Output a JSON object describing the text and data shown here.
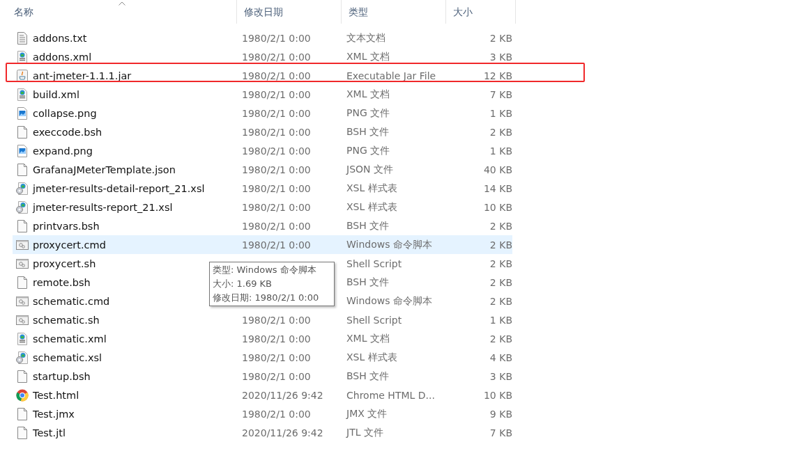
{
  "columns": [
    {
      "label": "名称",
      "sorted": true
    },
    {
      "label": "修改日期",
      "sorted": false
    },
    {
      "label": "类型",
      "sorted": false
    },
    {
      "label": "大小",
      "sorted": false
    }
  ],
  "files": [
    {
      "name": "addons.txt",
      "date": "1980/2/1 0:00",
      "type": "文本文档",
      "size": "2 KB",
      "kind": "text",
      "hovered": false,
      "highlighted": false
    },
    {
      "name": "addons.xml",
      "date": "1980/2/1 0:00",
      "type": "XML 文档",
      "size": "3 KB",
      "kind": "xml",
      "hovered": false,
      "highlighted": false
    },
    {
      "name": "ant-jmeter-1.1.1.jar",
      "date": "1980/2/1 0:00",
      "type": "Executable Jar File",
      "size": "12 KB",
      "kind": "jar",
      "hovered": false,
      "highlighted": true
    },
    {
      "name": "build.xml",
      "date": "1980/2/1 0:00",
      "type": "XML 文档",
      "size": "7 KB",
      "kind": "xml",
      "hovered": false,
      "highlighted": false
    },
    {
      "name": "collapse.png",
      "date": "1980/2/1 0:00",
      "type": "PNG 文件",
      "size": "1 KB",
      "kind": "image",
      "hovered": false,
      "highlighted": false
    },
    {
      "name": "execcode.bsh",
      "date": "1980/2/1 0:00",
      "type": "BSH 文件",
      "size": "2 KB",
      "kind": "blank",
      "hovered": false,
      "highlighted": false
    },
    {
      "name": "expand.png",
      "date": "1980/2/1 0:00",
      "type": "PNG 文件",
      "size": "1 KB",
      "kind": "image",
      "hovered": false,
      "highlighted": false
    },
    {
      "name": "GrafanaJMeterTemplate.json",
      "date": "1980/2/1 0:00",
      "type": "JSON 文件",
      "size": "40 KB",
      "kind": "blank",
      "hovered": false,
      "highlighted": false
    },
    {
      "name": "jmeter-results-detail-report_21.xsl",
      "date": "1980/2/1 0:00",
      "type": "XSL 样式表",
      "size": "14 KB",
      "kind": "xsl",
      "hovered": false,
      "highlighted": false
    },
    {
      "name": "jmeter-results-report_21.xsl",
      "date": "1980/2/1 0:00",
      "type": "XSL 样式表",
      "size": "10 KB",
      "kind": "xsl",
      "hovered": false,
      "highlighted": false
    },
    {
      "name": "printvars.bsh",
      "date": "1980/2/1 0:00",
      "type": "BSH 文件",
      "size": "2 KB",
      "kind": "blank",
      "hovered": false,
      "highlighted": false
    },
    {
      "name": "proxycert.cmd",
      "date": "1980/2/1 0:00",
      "type": "Windows 命令脚本",
      "size": "2 KB",
      "kind": "cmd",
      "hovered": true,
      "highlighted": false
    },
    {
      "name": "proxycert.sh",
      "type": "Shell Script",
      "size": "2 KB",
      "kind": "cmd",
      "hovered": false,
      "highlighted": false
    },
    {
      "name": "remote.bsh",
      "type": "BSH 文件",
      "size": "2 KB",
      "kind": "blank",
      "hovered": false,
      "highlighted": false
    },
    {
      "name": "schematic.cmd",
      "type": "Windows 命令脚本",
      "size": "2 KB",
      "kind": "cmd",
      "hovered": false,
      "highlighted": false
    },
    {
      "name": "schematic.sh",
      "date": "1980/2/1 0:00",
      "type": "Shell Script",
      "size": "1 KB",
      "kind": "cmd",
      "hovered": false,
      "highlighted": false
    },
    {
      "name": "schematic.xml",
      "date": "1980/2/1 0:00",
      "type": "XML 文档",
      "size": "2 KB",
      "kind": "xml",
      "hovered": false,
      "highlighted": false
    },
    {
      "name": "schematic.xsl",
      "date": "1980/2/1 0:00",
      "type": "XSL 样式表",
      "size": "4 KB",
      "kind": "xsl",
      "hovered": false,
      "highlighted": false
    },
    {
      "name": "startup.bsh",
      "date": "1980/2/1 0:00",
      "type": "BSH 文件",
      "size": "3 KB",
      "kind": "blank",
      "hovered": false,
      "highlighted": false
    },
    {
      "name": "Test.html",
      "date": "2020/11/26 9:42",
      "type": "Chrome HTML D...",
      "size": "10 KB",
      "kind": "chrome",
      "hovered": false,
      "highlighted": false
    },
    {
      "name": "Test.jmx",
      "date": "1980/2/1 0:00",
      "type": "JMX 文件",
      "size": "9 KB",
      "kind": "blank",
      "hovered": false,
      "highlighted": false
    },
    {
      "name": "Test.jtl",
      "date": "2020/11/26 9:42",
      "type": "JTL 文件",
      "size": "7 KB",
      "kind": "blank",
      "hovered": false,
      "highlighted": false
    }
  ],
  "tooltip": {
    "lines": [
      "类型: Windows 命令脚本",
      "大小: 1.69 KB",
      "修改日期: 1980/2/1 0:00"
    ]
  }
}
